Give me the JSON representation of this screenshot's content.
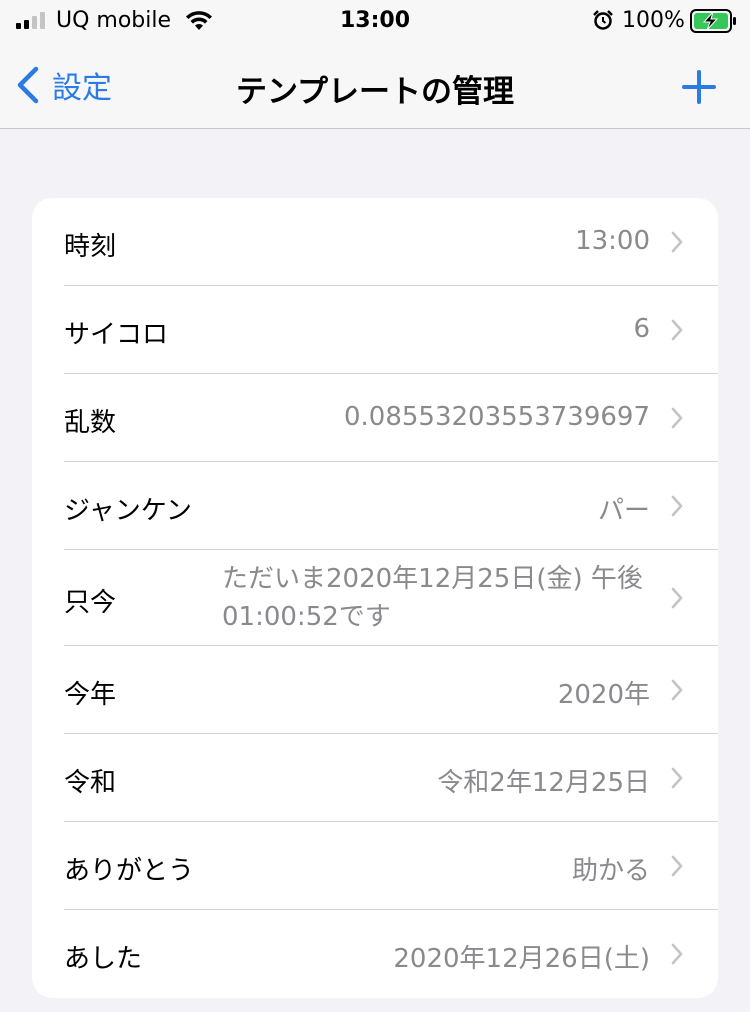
{
  "status_bar": {
    "carrier": "UQ mobile",
    "time": "13:00",
    "battery_percent": "100%"
  },
  "nav": {
    "back_label": "設定",
    "title": "テンプレートの管理",
    "accent_color": "#2a7be4"
  },
  "rows": [
    {
      "label": "時刻",
      "value": "13:00"
    },
    {
      "label": "サイコロ",
      "value": "6"
    },
    {
      "label": "乱数",
      "value": "0.08553203553739697"
    },
    {
      "label": "ジャンケン",
      "value": "パー"
    },
    {
      "label": "只今",
      "value_line1": "ただいま2020年12月25日(金) 午後",
      "value_line2": "01:00:52です"
    },
    {
      "label": "今年",
      "value": "2020年"
    },
    {
      "label": "令和",
      "value": "令和2年12月25日"
    },
    {
      "label": "ありがとう",
      "value": "助かる"
    },
    {
      "label": "あした",
      "value": "2020年12月26日(土)"
    }
  ]
}
